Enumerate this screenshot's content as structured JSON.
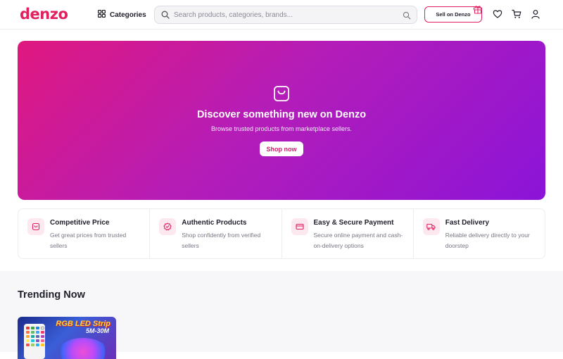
{
  "header": {
    "logo_text": "denzo",
    "categories_label": "Categories",
    "search_placeholder": "Search products, categories, brands...",
    "sell_label": "Sell on Denzo",
    "icons": [
      "grid-icon",
      "search-icon",
      "camera-search-icon",
      "gift-icon",
      "heart-icon",
      "cart-icon",
      "user-icon"
    ]
  },
  "hero": {
    "title": "Discover something new on Denzo",
    "subtitle": "Browse trusted products from marketplace sellers.",
    "cta": "Shop now",
    "icon": "shopping-bag-icon"
  },
  "features": [
    {
      "title": "Competitive Price",
      "desc": "Get great prices from trusted sellers",
      "icon": "price-bag-icon"
    },
    {
      "title": "Authentic Products",
      "desc": "Shop confidently from verified sellers",
      "icon": "verified-badge-icon"
    },
    {
      "title": "Easy & Secure Payment",
      "desc": "Secure online payment and cash-on-delivery options",
      "icon": "credit-card-icon"
    },
    {
      "title": "Fast Delivery",
      "desc": "Reliable delivery directly to your doorstep",
      "icon": "truck-icon"
    }
  ],
  "trending": {
    "title": "Trending Now",
    "products": [
      {
        "image_title": "RGB LED Strip",
        "image_sub": "5M-30M"
      }
    ]
  },
  "colors": {
    "brand": "#e0205f",
    "hero_start": "#e0187f",
    "hero_end": "#8b14d8"
  }
}
